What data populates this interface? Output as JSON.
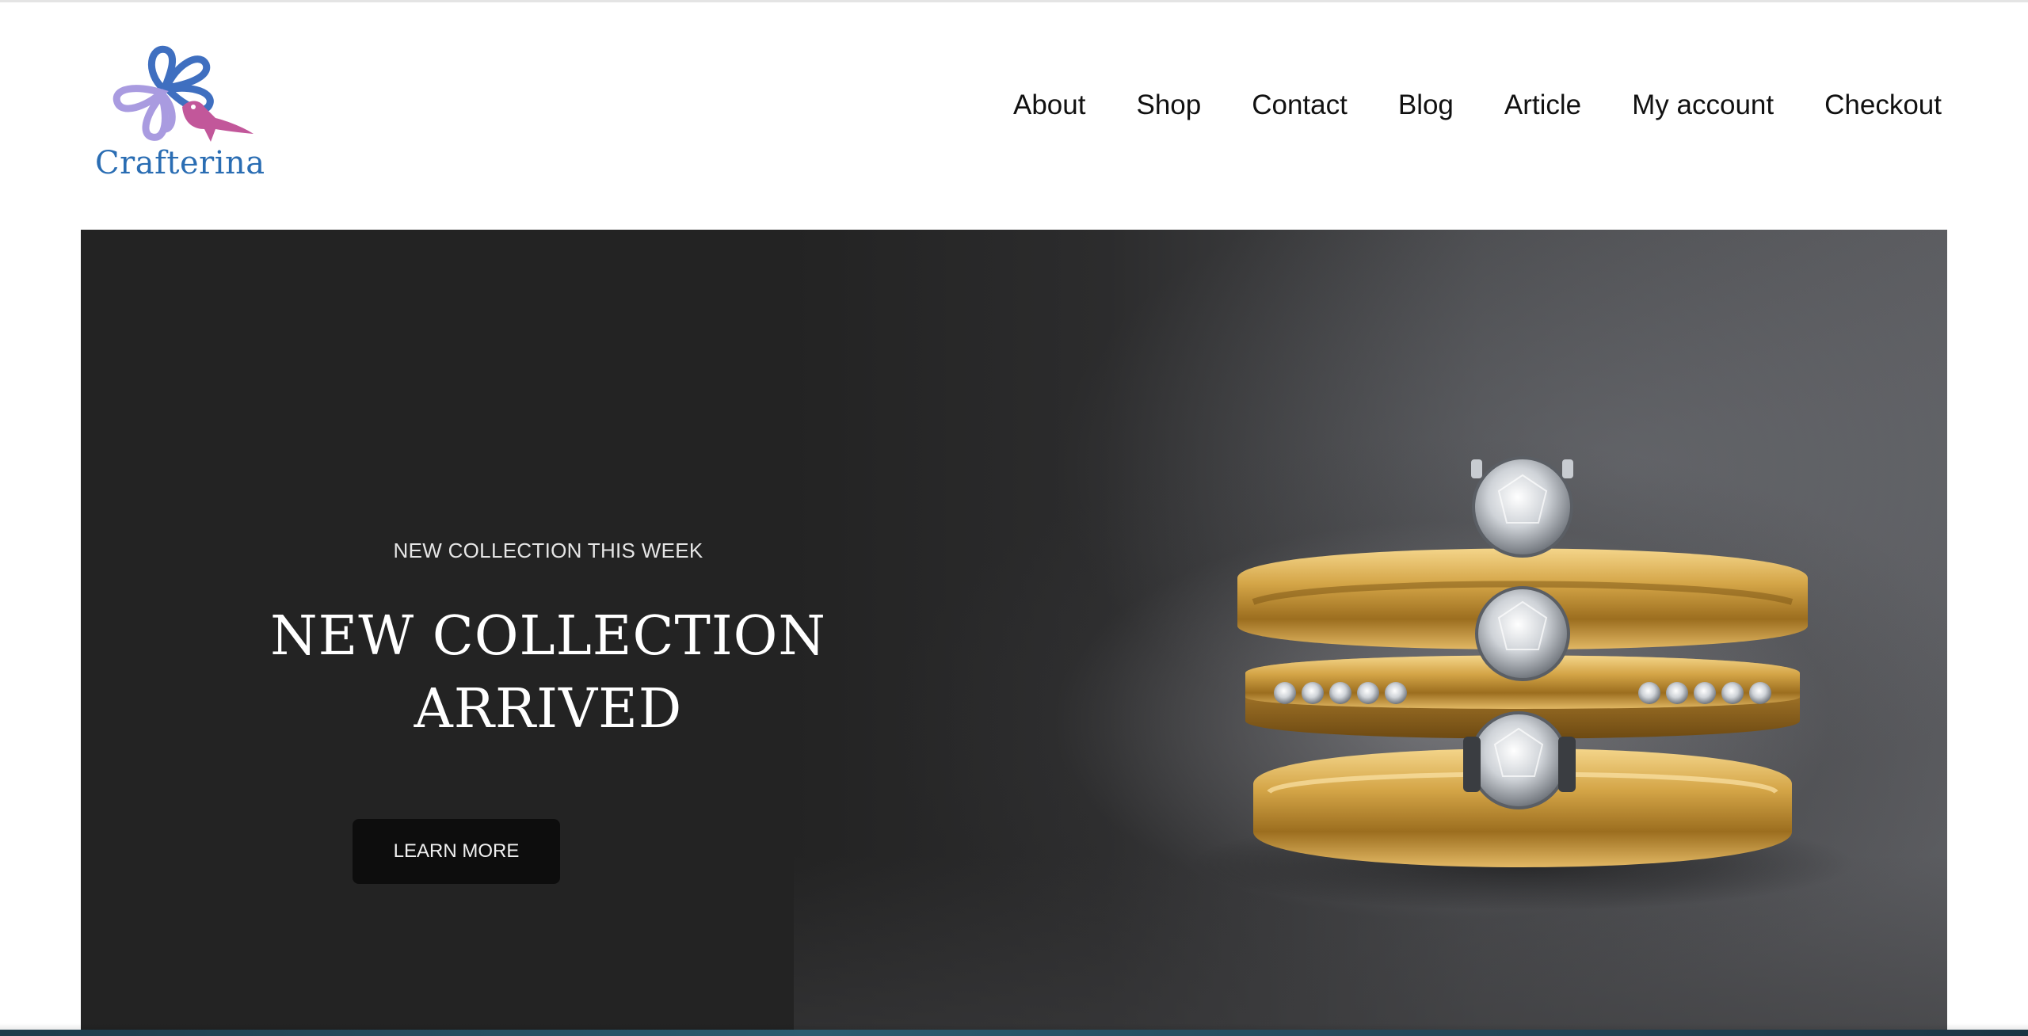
{
  "header": {
    "logo_text": "Crafterina",
    "nav": [
      {
        "label": "About"
      },
      {
        "label": "Shop"
      },
      {
        "label": "Contact"
      },
      {
        "label": "Blog"
      },
      {
        "label": "Article"
      },
      {
        "label": "My account"
      },
      {
        "label": "Checkout"
      }
    ]
  },
  "hero": {
    "eyebrow": "NEW COLLECTION THIS WEEK",
    "title_line1": "NEW COLLECTION",
    "title_line2": "ARRIVED",
    "button_label": "LEARN MORE",
    "image_subject": "stacked gold diamond rings"
  },
  "colors": {
    "logo_text": "#2a6db3",
    "logo_accent": "#c2579a",
    "hero_bg": "#232323",
    "button_bg": "#0d0d0d",
    "nav_text": "#111111"
  },
  "icons": {
    "logo": "flower-bird-logo-icon"
  }
}
